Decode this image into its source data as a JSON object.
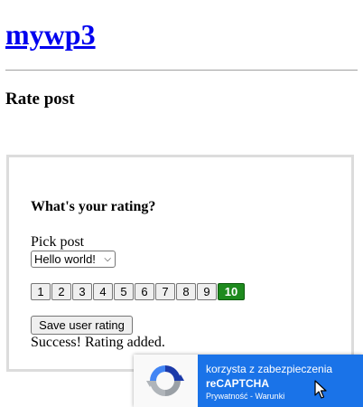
{
  "site": {
    "title": "mywp3"
  },
  "page": {
    "heading": "Rate post"
  },
  "rating_form": {
    "question": "What's your rating?",
    "pick_label": "Pick post",
    "selected_post": "Hello world!",
    "ratings": [
      "1",
      "2",
      "3",
      "4",
      "5",
      "6",
      "7",
      "8",
      "9",
      "10"
    ],
    "selected_rating": "10",
    "save_label": "Save user rating",
    "status_message": "Success! Rating added."
  },
  "recaptcha": {
    "line1": "korzysta z zabezpieczenia",
    "line2": "reCAPTCHA",
    "line3": "Prywatność - Warunki"
  },
  "colors": {
    "link": "#0000ee",
    "selected_rating": "#1e8a1e",
    "recaptcha_badge": "#1a73e8"
  },
  "icons": [
    "recaptcha-logo-icon",
    "chevron-down-icon",
    "mouse-cursor-icon"
  ]
}
